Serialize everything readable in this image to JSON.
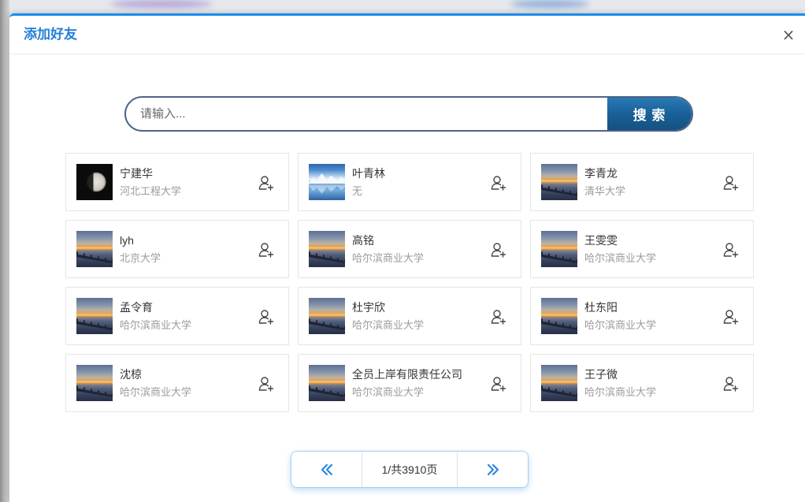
{
  "dialog": {
    "title": "添加好友",
    "close_label": "×"
  },
  "search": {
    "placeholder": "请输入...",
    "button_label": "搜 索"
  },
  "users": [
    {
      "name": "宁建华",
      "school": "河北工程大学",
      "avatar": "moon-photo"
    },
    {
      "name": "叶青林",
      "school": "无",
      "avatar": "mountain-lake-photo"
    },
    {
      "name": "李青龙",
      "school": "清华大学",
      "avatar": "sunset-pier-photo"
    },
    {
      "name": "lyh",
      "school": "北京大学",
      "avatar": "sunset-pier-photo"
    },
    {
      "name": "高铭",
      "school": "哈尔滨商业大学",
      "avatar": "sunset-pier-photo"
    },
    {
      "name": "王雯雯",
      "school": "哈尔滨商业大学",
      "avatar": "sunset-pier-photo"
    },
    {
      "name": "孟令育",
      "school": "哈尔滨商业大学",
      "avatar": "sunset-pier-photo"
    },
    {
      "name": "杜宇欣",
      "school": "哈尔滨商业大学",
      "avatar": "sunset-pier-photo"
    },
    {
      "name": "杜东阳",
      "school": "哈尔滨商业大学",
      "avatar": "sunset-pier-photo"
    },
    {
      "name": "沈椋",
      "school": "哈尔滨商业大学",
      "avatar": "sunset-pier-photo"
    },
    {
      "name": "全员上岸有限责任公司",
      "school": "哈尔滨商业大学",
      "avatar": "sunset-pier-photo"
    },
    {
      "name": "王子微",
      "school": "哈尔滨商业大学",
      "avatar": "sunset-pier-photo"
    }
  ],
  "icons": {
    "add_friend": "add-user-icon",
    "prev_page": "double-chevron-left-icon",
    "next_page": "double-chevron-right-icon"
  },
  "pagination": {
    "page_label": "1/共3910页"
  },
  "colors": {
    "accent": "#1a8ceb",
    "title": "#2580d8",
    "search_border": "#4c6586",
    "search_button": "#1a6098",
    "pager_icon": "#2b87e3"
  }
}
